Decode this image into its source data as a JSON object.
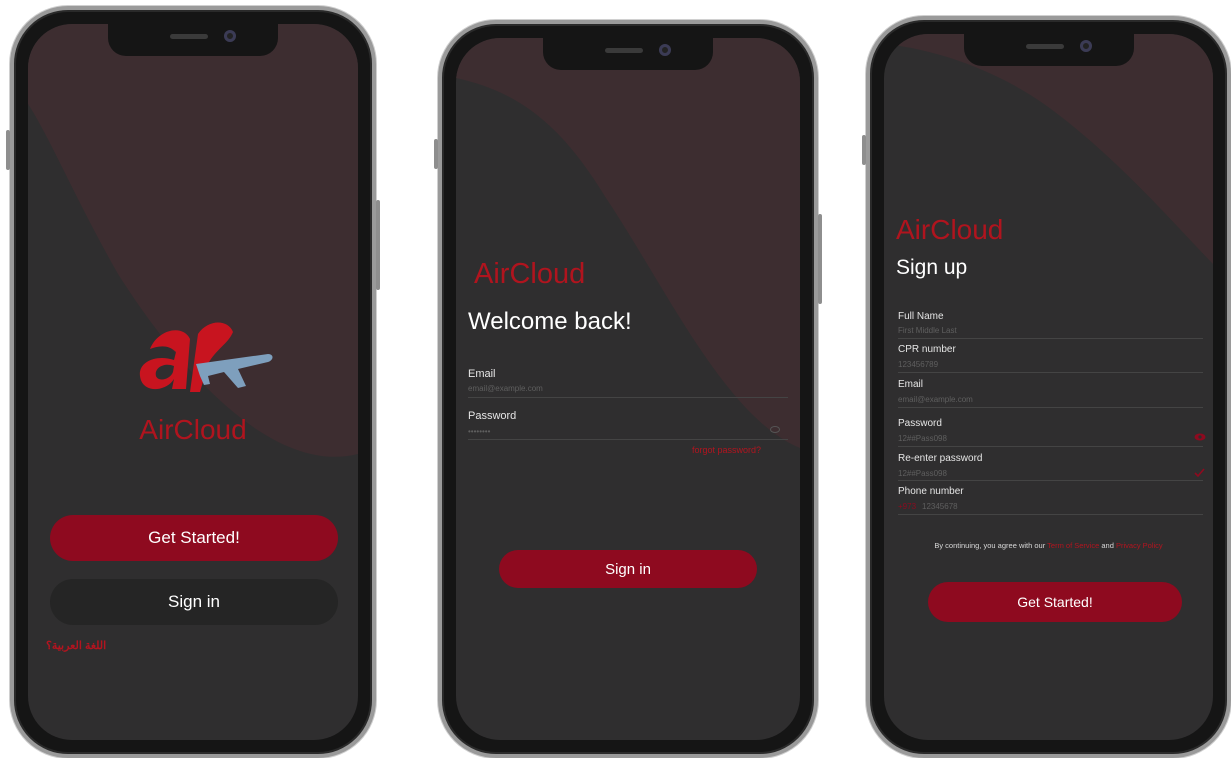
{
  "colors": {
    "brand": "#b0141e",
    "button": "#8e0a1f",
    "screen": "#2f2e2f"
  },
  "phone1": {
    "brand": "AirCloud",
    "logo_icon": "aircloud-logo-icon",
    "get_started": "Get Started!",
    "sign_in": "Sign in",
    "language_link": "اللغة العربية؟"
  },
  "phone2": {
    "brand": "AirCloud",
    "title": "Welcome back!",
    "email_label": "Email",
    "email_placeholder": "email@example.com",
    "password_label": "Password",
    "password_placeholder": "••••••••",
    "forgot": "forgot password?",
    "sign_in": "Sign in"
  },
  "phone3": {
    "brand": "AirCloud",
    "title": "Sign up",
    "fields": [
      {
        "label": "Full Name",
        "placeholder": "First Middle Last"
      },
      {
        "label": "CPR number",
        "placeholder": "123456789"
      },
      {
        "label": "Email",
        "placeholder": "email@example.com"
      },
      {
        "label": "Password",
        "placeholder": "12##Pass098"
      },
      {
        "label": "Re-enter password",
        "placeholder": "12##Pass098"
      },
      {
        "label": "Phone number",
        "placeholder": "12345678"
      }
    ],
    "phone_prefix": "+973",
    "terms_prefix": "By continuing, you agree with our",
    "terms_link": "Term of Service",
    "terms_and": "and",
    "privacy_link": "Privacy Policy",
    "get_started": "Get Started!"
  }
}
